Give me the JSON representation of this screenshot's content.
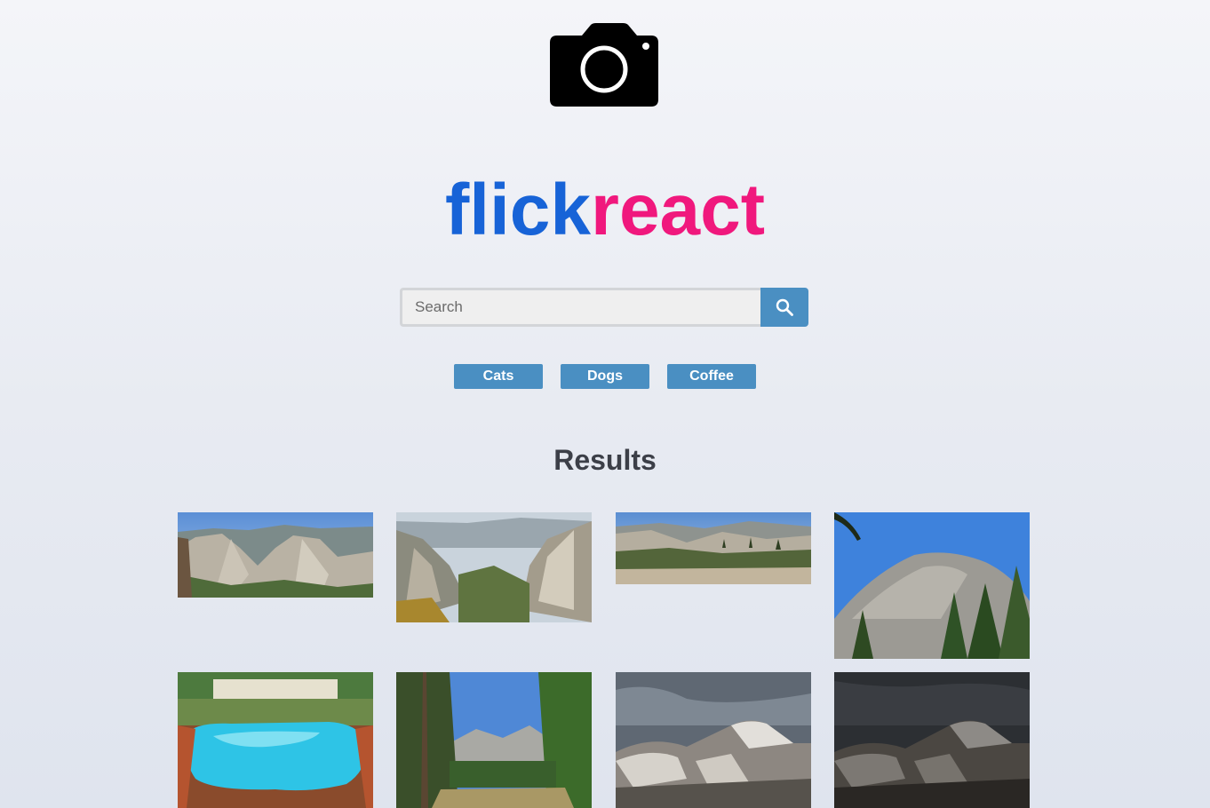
{
  "app": {
    "brand_part_1": "flick",
    "brand_part_2": "react",
    "logo_icon": "camera-icon"
  },
  "search": {
    "placeholder": "Search",
    "value": "",
    "button_icon": "search-icon"
  },
  "quick_links": [
    "Cats",
    "Dogs",
    "Coffee"
  ],
  "results": {
    "heading": "Results",
    "photos": [
      {
        "subject": "yosemite-valley-panorama"
      },
      {
        "subject": "yosemite-valley-view"
      },
      {
        "subject": "granite-ridge-panorama"
      },
      {
        "subject": "granite-dome-blue-sky"
      },
      {
        "subject": "indoor-pool"
      },
      {
        "subject": "river-forest-cliffs"
      },
      {
        "subject": "half-dome-snow"
      },
      {
        "subject": "half-dome-snow-dark"
      }
    ]
  },
  "colors": {
    "brand_blue": "#1763d7",
    "brand_pink": "#f0187d",
    "accent": "#4a8fc2",
    "heading": "#3c3f48"
  }
}
